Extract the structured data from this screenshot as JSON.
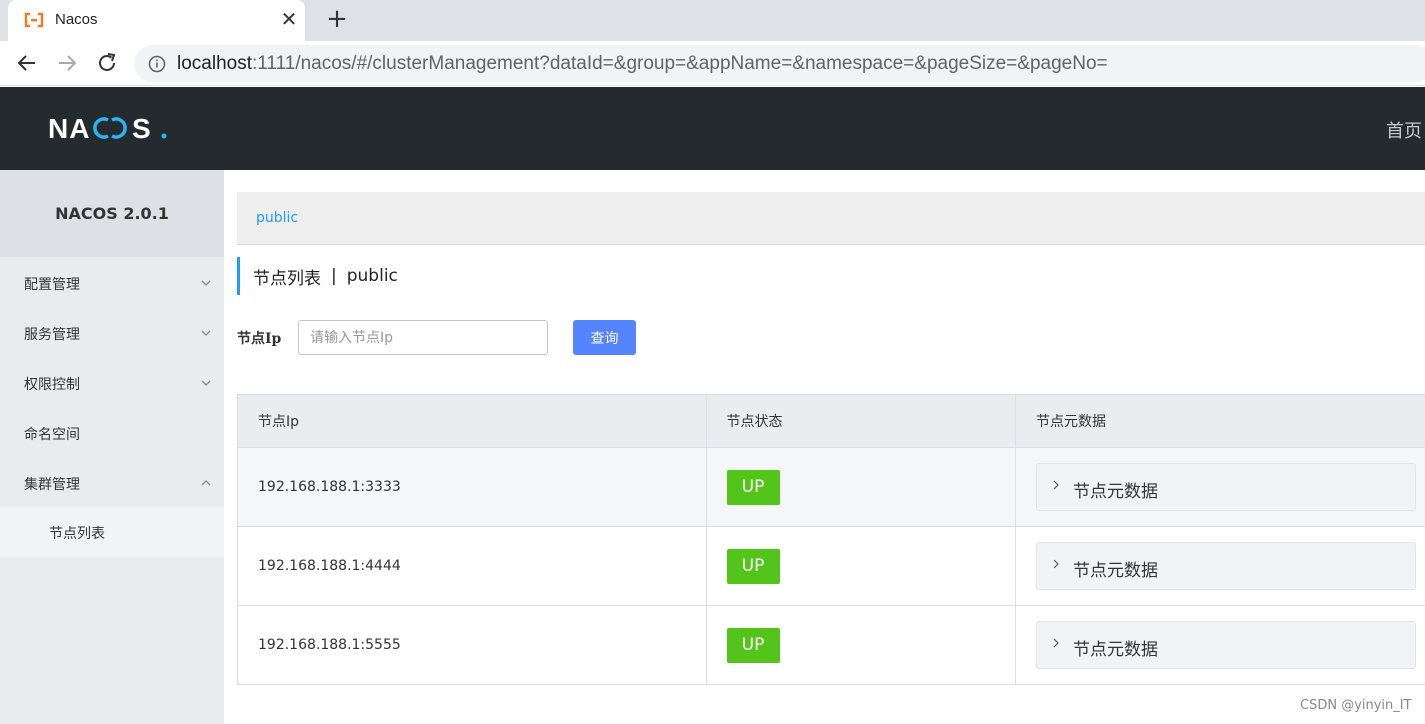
{
  "browser": {
    "tab_title": "Nacos",
    "url_host": "localhost",
    "url_rest": ":1111/nacos/#/clusterManagement?dataId=&group=&appName=&namespace=&pageSize=&pageNo="
  },
  "header": {
    "logo_text": "NACOS.",
    "home_link": "首页"
  },
  "sidebar": {
    "version": "NACOS 2.0.1",
    "items": [
      {
        "label": "配置管理",
        "expanded": false
      },
      {
        "label": "服务管理",
        "expanded": false
      },
      {
        "label": "权限控制",
        "expanded": false
      },
      {
        "label": "命名空间"
      },
      {
        "label": "集群管理",
        "expanded": true
      }
    ],
    "subitems": [
      {
        "label": "节点列表"
      }
    ]
  },
  "main": {
    "namespace": "public",
    "title": "节点列表",
    "title_sep": "|",
    "title_ns": "public",
    "filter": {
      "label": "节点Ip",
      "placeholder": "请输入节点Ip",
      "value": "",
      "button": "查询"
    },
    "table": {
      "columns": [
        "节点Ip",
        "节点状态",
        "节点元数据"
      ],
      "rows": [
        {
          "ip": "192.168.188.1:3333",
          "status": "UP",
          "meta": "节点元数据"
        },
        {
          "ip": "192.168.188.1:4444",
          "status": "UP",
          "meta": "节点元数据"
        },
        {
          "ip": "192.168.188.1:5555",
          "status": "UP",
          "meta": "节点元数据"
        }
      ]
    }
  },
  "watermark": "CSDN @yinyin_IT",
  "colors": {
    "header_bg": "#252a2f",
    "accent": "#209bfa",
    "button": "#5584ff",
    "status_up": "#52c41a",
    "logo_accent": "#29b6f6"
  }
}
